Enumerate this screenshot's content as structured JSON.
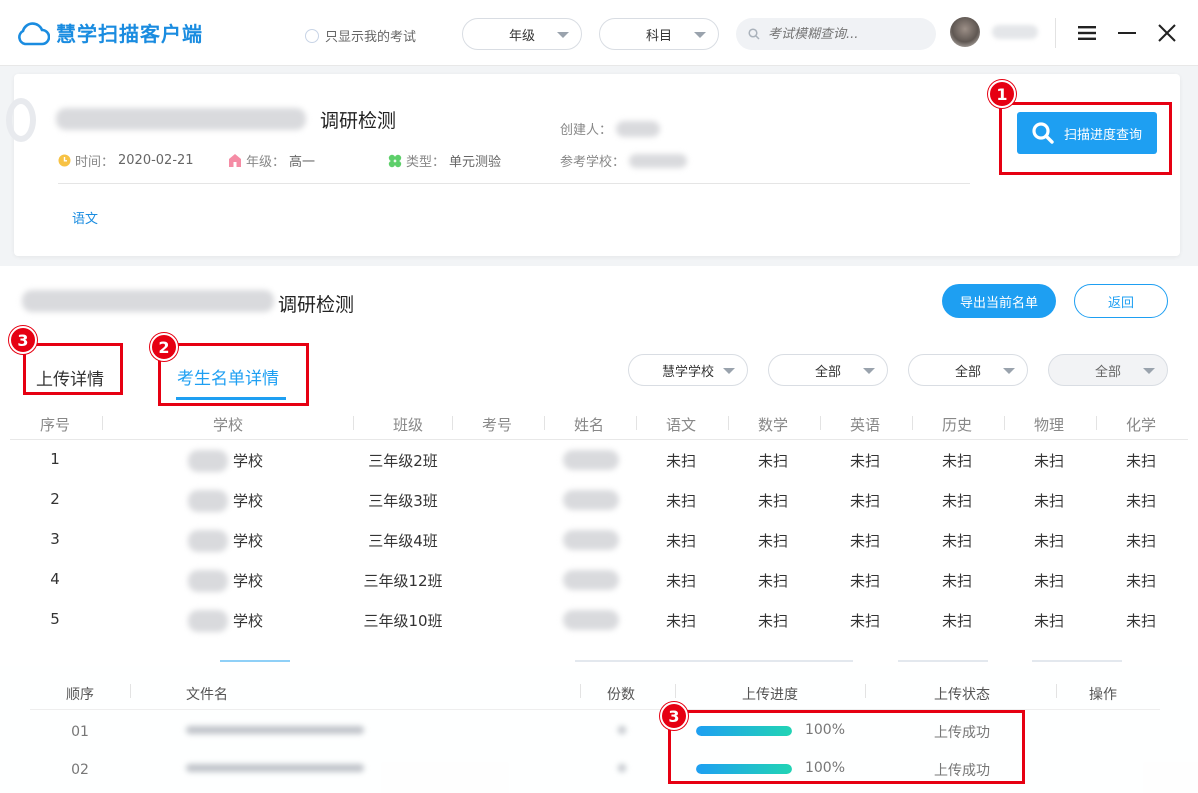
{
  "app": {
    "title": "慧学扫描客户端"
  },
  "topbar": {
    "only_mine_label": "只显示我的考试",
    "grade_select": "年级",
    "subject_select": "科目",
    "search_placeholder": "考试模糊查询..."
  },
  "exam": {
    "title_suffix": "调研检测",
    "time_label": "时间：",
    "time_value": "2020-02-21",
    "grade_label": "年级：",
    "grade_value": "高一",
    "type_label": "类型：",
    "type_value": "单元测验",
    "creator_label": "创建人：",
    "school_label": "参考学校：",
    "subject_link": "语文",
    "scan_button": "扫描进度查询"
  },
  "annotations": {
    "badge1": "1",
    "badge2": "2",
    "badge3a": "3",
    "badge3b": "3"
  },
  "list": {
    "title_suffix": "调研检测",
    "export_button": "导出当前名单",
    "back_button": "返回",
    "tab_upload": "上传详情",
    "tab_roster": "考生名单详情",
    "filters": [
      "慧学学校",
      "全部",
      "全部",
      "全部"
    ],
    "headers": [
      "序号",
      "学校",
      "班级",
      "考号",
      "姓名",
      "语文",
      "数学",
      "英语",
      "历史",
      "物理",
      "化学"
    ],
    "rows": [
      {
        "no": "1",
        "school": "学校",
        "class": "三年级2班",
        "status": [
          "未扫",
          "未扫",
          "未扫",
          "未扫",
          "未扫",
          "未扫"
        ]
      },
      {
        "no": "2",
        "school": "学校",
        "class": "三年级3班",
        "status": [
          "未扫",
          "未扫",
          "未扫",
          "未扫",
          "未扫",
          "未扫"
        ]
      },
      {
        "no": "3",
        "school": "学校",
        "class": "三年级4班",
        "status": [
          "未扫",
          "未扫",
          "未扫",
          "未扫",
          "未扫",
          "未扫"
        ]
      },
      {
        "no": "4",
        "school": "学校",
        "class": "三年级12班",
        "status": [
          "未扫",
          "未扫",
          "未扫",
          "未扫",
          "未扫",
          "未扫"
        ]
      },
      {
        "no": "5",
        "school": "学校",
        "class": "三年级10班",
        "status": [
          "未扫",
          "未扫",
          "未扫",
          "未扫",
          "未扫",
          "未扫"
        ]
      }
    ]
  },
  "upload": {
    "headers": [
      "顺序",
      "文件名",
      "份数",
      "上传进度",
      "上传状态",
      "操作"
    ],
    "rows": [
      {
        "order": "01",
        "progress": 1.0,
        "progress_text": "100%",
        "status": "上传成功"
      },
      {
        "order": "02",
        "progress": 1.0,
        "progress_text": "100%",
        "status": "上传成功"
      }
    ]
  },
  "colors": {
    "accent": "#1e9ff2",
    "highlight": "#e60012"
  }
}
